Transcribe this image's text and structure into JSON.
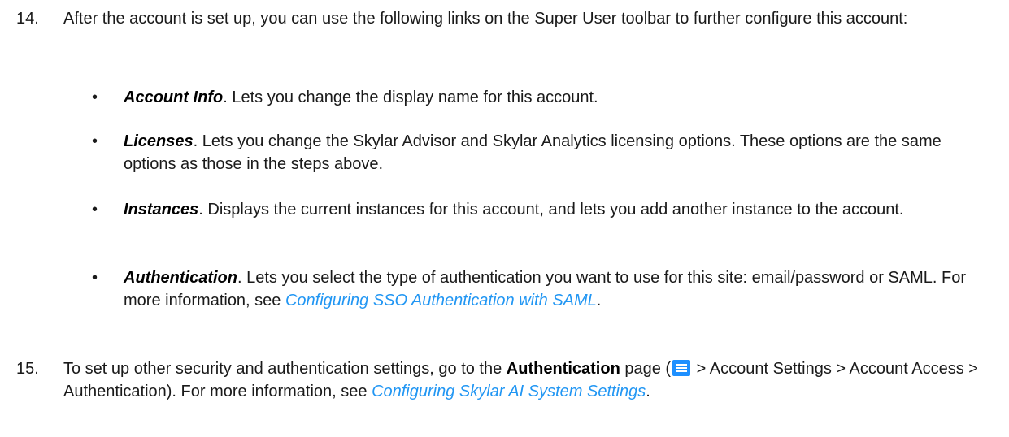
{
  "step14": {
    "number": "14.",
    "text": "After the account is set up, you can use the following links on the Super User toolbar to further configure this account:",
    "bullets": [
      {
        "term": "Account Info",
        "text": ". Lets you change the display name for this account."
      },
      {
        "term": "Licenses",
        "text": ". Lets you change the Skylar Advisor and Skylar Analytics licensing options. These options are the same options as those in the steps above."
      },
      {
        "term": "Instances",
        "text": ". Displays the current instances for this account, and lets you add another instance to the account."
      },
      {
        "term": "Authentication",
        "text": ". Lets you select the type of authentication you want to use for this site: email/password or SAML. For more information, see ",
        "link": "Configuring SSO Authentication with SAML",
        "after": "."
      }
    ]
  },
  "step15": {
    "number": "15.",
    "text_before": "To set up other security and authentication settings, go to the ",
    "bold": "Authentication",
    "text_mid": " page (",
    "menu_icon": "hamburger-menu-icon",
    "text_after": " > Account Settings > Account Access > Authentication). For more information, see ",
    "link": "Configuring Skylar AI System Settings",
    "end": "."
  },
  "colors": {
    "link": "#2196f3",
    "menu_icon_bg": "#1e90ff",
    "text": "#1a1a1a"
  }
}
